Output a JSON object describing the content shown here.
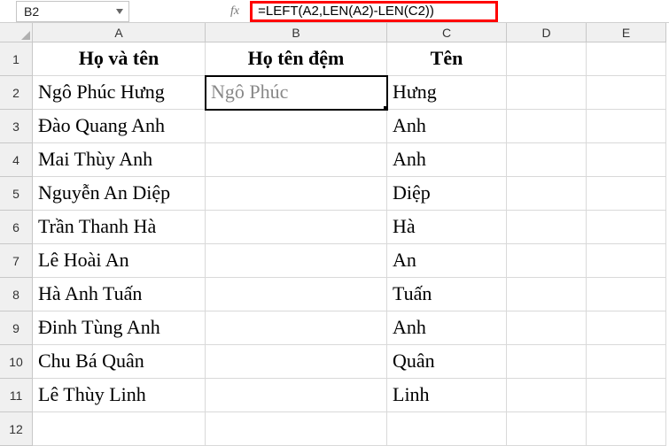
{
  "namebox": {
    "value": "B2"
  },
  "fx_label": "fx",
  "formula": "=LEFT(A2,LEN(A2)-LEN(C2))",
  "columns": [
    "A",
    "B",
    "C",
    "D",
    "E"
  ],
  "rows": [
    "1",
    "2",
    "3",
    "4",
    "5",
    "6",
    "7",
    "8",
    "9",
    "10",
    "11",
    "12"
  ],
  "headers": {
    "A": "Họ và tên",
    "B": "Họ tên đệm",
    "C": "Tên"
  },
  "selected_cell": "B2",
  "selected_display": "Ngô Phúc",
  "data": [
    {
      "A": "Ngô Phúc Hưng",
      "B": "Ngô Phúc",
      "C": "Hưng"
    },
    {
      "A": "Đào Quang Anh",
      "B": "",
      "C": "Anh"
    },
    {
      "A": "Mai Thùy Anh",
      "B": "",
      "C": "Anh"
    },
    {
      "A": "Nguyễn An Diệp",
      "B": "",
      "C": "Diệp"
    },
    {
      "A": "Trần Thanh Hà",
      "B": "",
      "C": "Hà"
    },
    {
      "A": "Lê Hoài An",
      "B": "",
      "C": "An"
    },
    {
      "A": "Hà Anh Tuấn",
      "B": "",
      "C": "Tuấn"
    },
    {
      "A": "Đinh Tùng Anh",
      "B": "",
      "C": "Anh"
    },
    {
      "A": "Chu Bá Quân",
      "B": "",
      "C": "Quân"
    },
    {
      "A": "Lê Thùy Linh",
      "B": "",
      "C": "Linh"
    }
  ]
}
